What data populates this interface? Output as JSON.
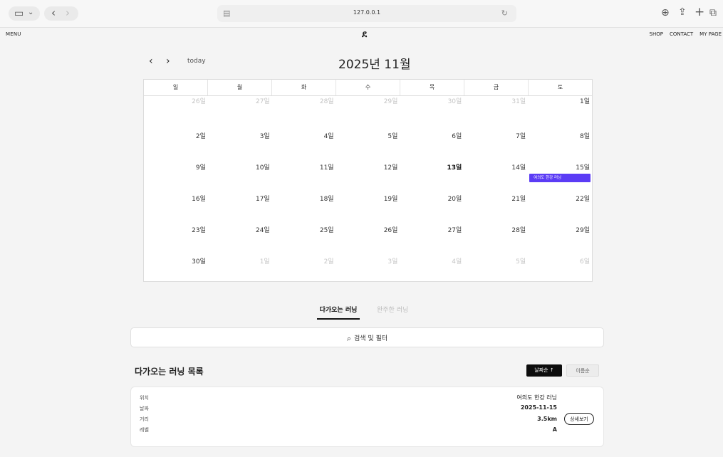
{
  "browser": {
    "url": "127.0.0.1"
  },
  "header": {
    "menu": "MENU",
    "logo": "ደ",
    "links": [
      "SHOP",
      "CONTACT",
      "MY PAGE"
    ]
  },
  "calendar": {
    "prev": "‹",
    "next": "›",
    "today": "today",
    "title": "2025년 11월",
    "weekdays": [
      "일",
      "월",
      "화",
      "수",
      "목",
      "금",
      "토"
    ],
    "weeks": [
      [
        "26일",
        "27일",
        "28일",
        "29일",
        "30일",
        "31일",
        "1일"
      ],
      [
        "2일",
        "3일",
        "4일",
        "5일",
        "6일",
        "7일",
        "8일"
      ],
      [
        "9일",
        "10일",
        "11일",
        "12일",
        "13일",
        "14일",
        "15일"
      ],
      [
        "16일",
        "17일",
        "18일",
        "19일",
        "20일",
        "21일",
        "22일"
      ],
      [
        "23일",
        "24일",
        "25일",
        "26일",
        "27일",
        "28일",
        "29일"
      ],
      [
        "30일",
        "1일",
        "2일",
        "3일",
        "4일",
        "5일",
        "6일"
      ]
    ],
    "event": "여의도 한강 러닝"
  },
  "tabs": {
    "upcoming": "다가오는 러닝",
    "done": "완주한 러닝"
  },
  "search": {
    "label": "검색 및 필터"
  },
  "list": {
    "title": "다가오는 러닝 목록",
    "sort_date": "날짜순 ↑",
    "sort_name": "이름순",
    "labels": [
      "위치",
      "날짜",
      "거리",
      "레벨"
    ],
    "item": {
      "name": "여의도 한강 러닝",
      "date": "2025-11-15",
      "distance": "3.5km",
      "level": "A",
      "detail": "상세보기"
    }
  }
}
